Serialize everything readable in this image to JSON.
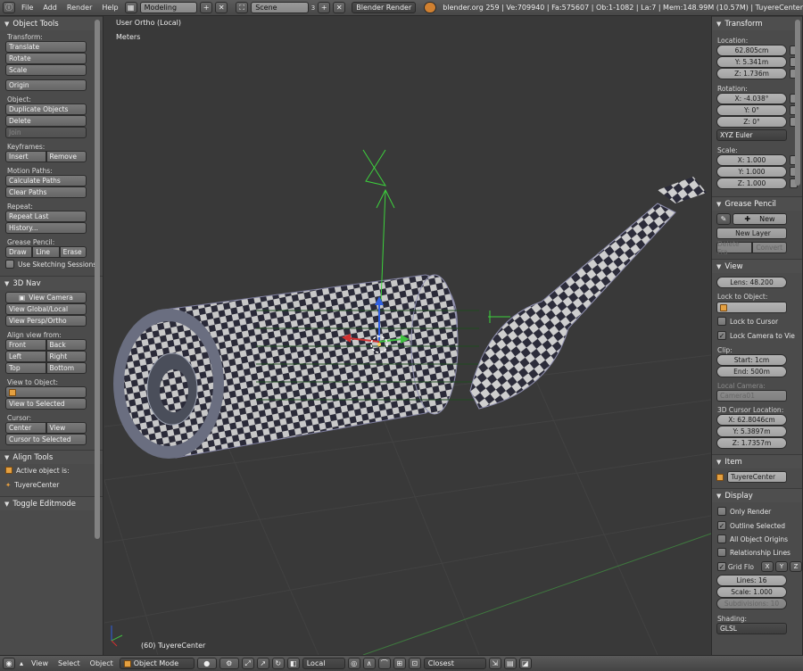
{
  "topbar": {
    "menus": [
      "File",
      "Add",
      "Render",
      "Help"
    ],
    "screen_layout": "Modeling",
    "scene": "Scene",
    "scene_users": "3",
    "render_engine": "Blender Render",
    "stats": "blender.org 259 | Ve:709940 | Fa:575607 | Ob:1-1082 | La:7 | Mem:148.99M (10.57M) | TuyereCenter"
  },
  "left_panel": {
    "object_tools": {
      "title": "Object Tools",
      "transform_label": "Transform:",
      "translate": "Translate",
      "rotate": "Rotate",
      "scale": "Scale",
      "origin": "Origin",
      "object_label": "Object:",
      "duplicate": "Duplicate Objects",
      "delete": "Delete",
      "join": "Join",
      "keyframes_label": "Keyframes:",
      "insert": "Insert",
      "remove": "Remove",
      "motion_paths_label": "Motion Paths:",
      "calculate_paths": "Calculate Paths",
      "clear_paths": "Clear Paths",
      "repeat_label": "Repeat:",
      "repeat_last": "Repeat Last",
      "history": "History...",
      "grease_label": "Grease Pencil:",
      "draw": "Draw",
      "line": "Line",
      "erase": "Erase",
      "use_sketching": "Use Sketching Sessions"
    },
    "nav": {
      "title": "3D Nav",
      "view_camera": "View Camera",
      "view_global_local": "View Global/Local",
      "view_persp_ortho": "View Persp/Ortho",
      "align_view_label": "Align view from:",
      "front": "Front",
      "back": "Back",
      "left": "Left",
      "right": "Right",
      "top": "Top",
      "bottom": "Bottom",
      "view_to_object_label": "View to Object:",
      "view_to_selected": "View to Selected",
      "cursor_label": "Cursor:",
      "center": "Center",
      "view": "View",
      "cursor_to_selected": "Cursor to Selected"
    },
    "align_tools": {
      "title": "Align Tools",
      "active_label": "Active object is:",
      "active_object": "TuyereCenter"
    },
    "toggle_editmode": {
      "title": "Toggle Editmode"
    }
  },
  "viewport": {
    "view_label": "User Ortho (Local)",
    "units": "Meters",
    "object_label": "(60) TuyereCenter"
  },
  "right_panel": {
    "transform": {
      "title": "Transform",
      "location_label": "Location:",
      "loc_x": "62.805cm",
      "loc_y": "Y: 5.341m",
      "loc_z": "Z: 1.736m",
      "rotation_label": "Rotation:",
      "rot_x": "X: -4.038°",
      "rot_y": "Y: 0°",
      "rot_z": "Z: 0°",
      "rotation_mode": "XYZ Euler",
      "scale_label": "Scale:",
      "scale_x": "X: 1.000",
      "scale_y": "Y: 1.000",
      "scale_z": "Z: 1.000"
    },
    "grease_pencil": {
      "title": "Grease Pencil",
      "new": "New",
      "new_layer": "New Layer",
      "delete_frame": "Delete Fra",
      "convert": "Convert"
    },
    "view": {
      "title": "View",
      "lens": "Lens: 48.200",
      "lock_to_object_label": "Lock to Object:",
      "lock_to_cursor": "Lock to Cursor",
      "lock_camera": "Lock Camera to Vie",
      "clip_label": "Clip:",
      "clip_start": "Start: 1cm",
      "clip_end": "End: 500m",
      "local_camera_label": "Local Camera:",
      "local_camera": "Camera01",
      "cursor_location_label": "3D Cursor Location:",
      "cursor_x": "X: 62.8046cm",
      "cursor_y": "Y: 5.3897m",
      "cursor_z": "Z: 1.7357m"
    },
    "item": {
      "title": "Item",
      "name": "TuyereCenter"
    },
    "display": {
      "title": "Display",
      "only_render": "Only Render",
      "outline_selected": "Outline Selected",
      "all_object_origins": "All Object Origins",
      "relationship_lines": "Relationship Lines",
      "grid_floor": "Grid Flo",
      "axis_x": "X",
      "axis_y": "Y",
      "axis_z": "Z",
      "lines": "Lines: 16",
      "scale": "Scale: 1.000",
      "subdivisions": "Subdivisions: 10",
      "shading_label": "Shading:",
      "shading": "GLSL"
    }
  },
  "bottombar": {
    "view": "View",
    "select": "Select",
    "object": "Object",
    "mode": "Object Mode",
    "pivot": "Local",
    "snap": "Closest"
  },
  "colors": {
    "axis_x": "#d03030",
    "axis_y": "#40c040",
    "axis_z": "#3060e0",
    "checker_dark": "#2a2a38",
    "checker_light": "#c8c8c8"
  }
}
